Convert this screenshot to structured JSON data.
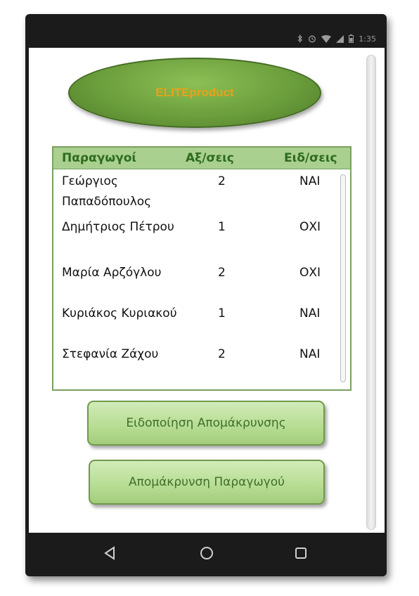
{
  "status_bar": {
    "time": "1:35",
    "icons": [
      "bluetooth-icon",
      "alarm-icon",
      "wifi-icon",
      "signal-icon",
      "battery-icon"
    ]
  },
  "logo": {
    "text": "ELITEproduct",
    "text_color": "#e8a21a",
    "fill_color": "#6b9e3c"
  },
  "table": {
    "headers": [
      "Παραγωγοί",
      "Αξ/σεις",
      "Ειδ/σεις"
    ],
    "header_bg": "#a9d08e",
    "rows": [
      {
        "name": "Γεώργιος Παπαδόπουλος",
        "count": "2",
        "notified": "ΝΑΙ"
      },
      {
        "name": "Δημήτριος Πέτρου",
        "count": "1",
        "notified": "ΟΧΙ"
      },
      {
        "name": "Μαρία Αρζόγλου",
        "count": "2",
        "notified": "ΟΧΙ"
      },
      {
        "name": "Κυριάκος Κυριακού",
        "count": "1",
        "notified": "ΝΑΙ"
      },
      {
        "name": "Στεφανία Ζάχου",
        "count": "2",
        "notified": "ΝΑΙ"
      }
    ]
  },
  "buttons": {
    "notify_removal": "Ειδοποίηση Απομάκρυνσης",
    "remove_producer": "Απομάκρυνση Παραγωγού"
  },
  "nav_bar": {
    "icons": [
      "back-icon",
      "home-icon",
      "recents-icon"
    ]
  }
}
